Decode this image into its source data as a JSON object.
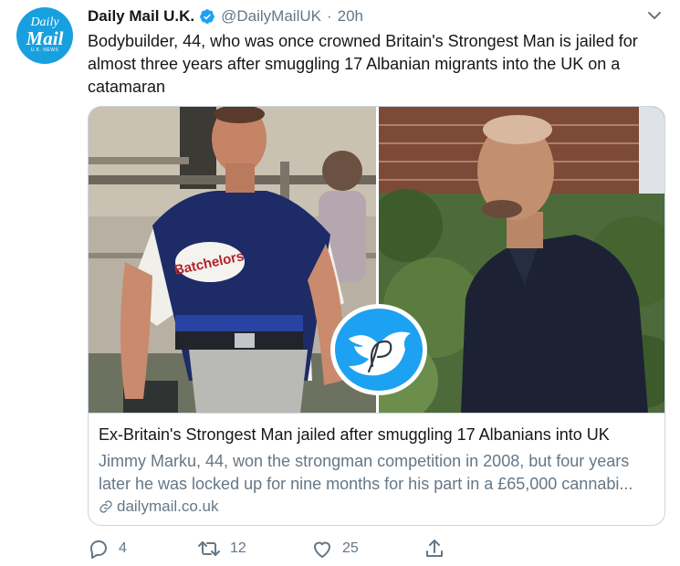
{
  "account": {
    "avatar": {
      "line1": "Daily",
      "line2": "Mail",
      "line3": "U.K. NEWS"
    },
    "name": "Daily Mail U.K.",
    "verified": true,
    "handle": "@DailyMailUK",
    "separator": "·",
    "time": "20h"
  },
  "tweet": {
    "text": "Bodybuilder, 44, who was once crowned Britain's Strongest Man is jailed for almost three years after smuggling 17 Albanian migrants into the UK on a catamaran"
  },
  "card": {
    "title": "Ex-Britain's Strongest Man jailed after smuggling 17 Albanians into UK",
    "description": "Jimmy Marku, 44, won the strongman competition in 2008, but four years later he was locked up for nine months for his part in a £65,000 cannabi...",
    "domain": "dailymail.co.uk",
    "shirt_logo": "Batchelors"
  },
  "actions": {
    "replies": "4",
    "retweets": "12",
    "likes": "25"
  },
  "icons": {
    "verified": "verified-badge-icon",
    "menu": "chevron-down-icon",
    "link": "link-icon",
    "reply": "reply-icon",
    "retweet": "retweet-icon",
    "like": "heart-icon",
    "share": "share-icon"
  },
  "colors": {
    "brand": "#1da1f2",
    "avatar_bg": "#18a0de",
    "text": "#14171a",
    "muted": "#657786",
    "border": "#ccd6dd"
  }
}
